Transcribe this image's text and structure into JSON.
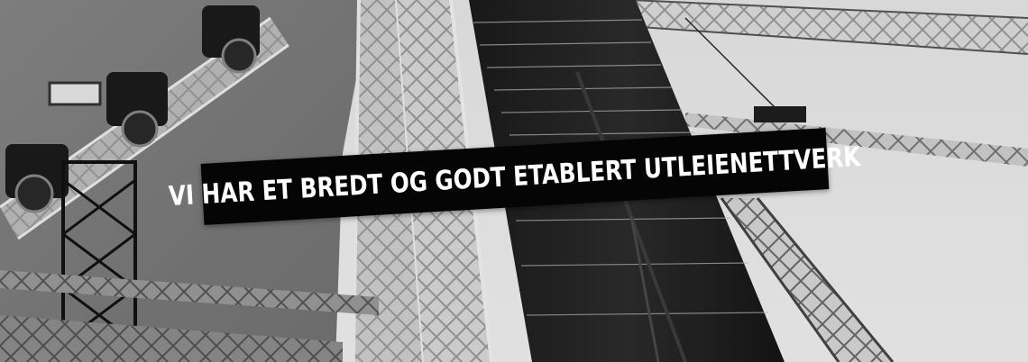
{
  "hero": {
    "banner_text": "VI HAR ET BREDT OG GODT ETABLERT UTLEIENETTVERK",
    "image_description_icon": "stage-truss-speaker-photo"
  },
  "colors": {
    "banner_background": "#050505",
    "banner_text": "#ffffff"
  }
}
